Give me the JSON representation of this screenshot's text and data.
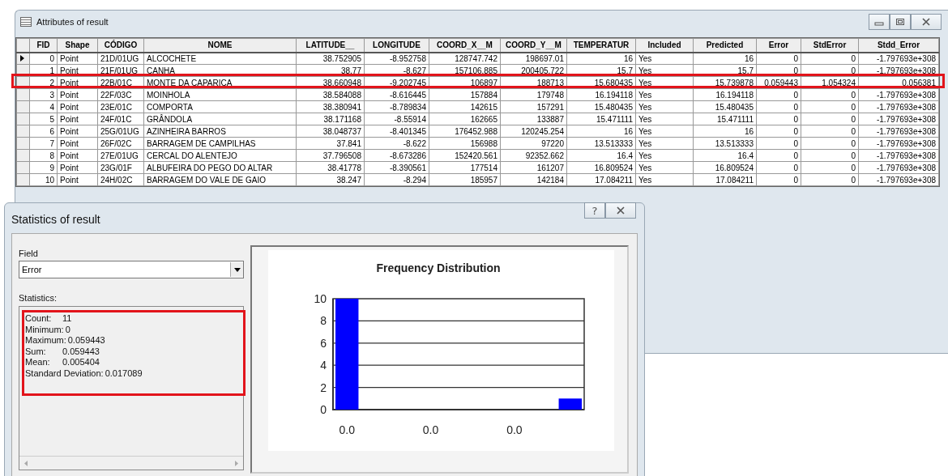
{
  "attributes_window": {
    "title": "Attributes of result"
  },
  "table": {
    "columns": [
      "FID",
      "Shape",
      "CÓDIGO",
      "NOME",
      "LATITUDE__",
      "LONGITUDE",
      "COORD_X__M",
      "COORD_Y__M",
      "TEMPERATUR",
      "Included",
      "Predicted",
      "Error",
      "StdError",
      "Stdd_Error"
    ],
    "rows": [
      {
        "current": true,
        "highlighted": false,
        "cells": [
          "0",
          "Point",
          "21D/01UG",
          "ALCOCHETE",
          "38.752905",
          "-8.952758",
          "128747.742",
          "198697.01",
          "16",
          "Yes",
          "16",
          "0",
          "0",
          "-1.797693e+308"
        ]
      },
      {
        "current": false,
        "highlighted": false,
        "cells": [
          "1",
          "Point",
          "21F/01UG",
          "CANHA",
          "38.77",
          "-8.627",
          "157106.885",
          "200405.722",
          "15.7",
          "Yes",
          "15.7",
          "0",
          "0",
          "-1.797693e+308"
        ]
      },
      {
        "current": false,
        "highlighted": true,
        "cells": [
          "2",
          "Point",
          "22B/01C",
          "MONTE DA CAPARICA",
          "38.660948",
          "-9.202745",
          "106897",
          "188713",
          "15.680435",
          "Yes",
          "15.739878",
          "0.059443",
          "1.054324",
          "0.056381"
        ]
      },
      {
        "current": false,
        "highlighted": false,
        "cells": [
          "3",
          "Point",
          "22F/03C",
          "MOINHOLA",
          "38.584088",
          "-8.616445",
          "157884",
          "179748",
          "16.194118",
          "Yes",
          "16.194118",
          "0",
          "0",
          "-1.797693e+308"
        ]
      },
      {
        "current": false,
        "highlighted": false,
        "cells": [
          "4",
          "Point",
          "23E/01C",
          "COMPORTA",
          "38.380941",
          "-8.789834",
          "142615",
          "157291",
          "15.480435",
          "Yes",
          "15.480435",
          "0",
          "0",
          "-1.797693e+308"
        ]
      },
      {
        "current": false,
        "highlighted": false,
        "cells": [
          "5",
          "Point",
          "24F/01C",
          "GRÂNDOLA",
          "38.171168",
          "-8.55914",
          "162665",
          "133887",
          "15.471111",
          "Yes",
          "15.471111",
          "0",
          "0",
          "-1.797693e+308"
        ]
      },
      {
        "current": false,
        "highlighted": false,
        "cells": [
          "6",
          "Point",
          "25G/01UG",
          "AZINHEIRA BARROS",
          "38.048737",
          "-8.401345",
          "176452.988",
          "120245.254",
          "16",
          "Yes",
          "16",
          "0",
          "0",
          "-1.797693e+308"
        ]
      },
      {
        "current": false,
        "highlighted": false,
        "cells": [
          "7",
          "Point",
          "26F/02C",
          "BARRAGEM DE CAMPILHAS",
          "37.841",
          "-8.622",
          "156988",
          "97220",
          "13.513333",
          "Yes",
          "13.513333",
          "0",
          "0",
          "-1.797693e+308"
        ]
      },
      {
        "current": false,
        "highlighted": false,
        "cells": [
          "8",
          "Point",
          "27E/01UG",
          "CERCAL DO ALENTEJO",
          "37.796508",
          "-8.673286",
          "152420.561",
          "92352.662",
          "16.4",
          "Yes",
          "16.4",
          "0",
          "0",
          "-1.797693e+308"
        ]
      },
      {
        "current": false,
        "highlighted": false,
        "cells": [
          "9",
          "Point",
          "23G/01F",
          "ALBUFEIRA DO PEGO DO ALTAR",
          "38.41778",
          "-8.390561",
          "177514",
          "161207",
          "16.809524",
          "Yes",
          "16.809524",
          "0",
          "0",
          "-1.797693e+308"
        ]
      },
      {
        "current": false,
        "highlighted": false,
        "cells": [
          "10",
          "Point",
          "24H/02C",
          "BARRAGEM DO VALE DE GAIO",
          "38.247",
          "-8.294",
          "185957",
          "142184",
          "17.084211",
          "Yes",
          "17.084211",
          "0",
          "0",
          "-1.797693e+308"
        ]
      }
    ]
  },
  "statistics_dialog": {
    "title": "Statistics of result",
    "help": "?",
    "field_label": "Field",
    "field_value": "Error",
    "statistics_label": "Statistics:",
    "statistics": [
      {
        "label": "Count:",
        "value": "11"
      },
      {
        "label": "Minimum:",
        "value": "0"
      },
      {
        "label": "Maximum:",
        "value": "0.059443"
      },
      {
        "label": "Sum:",
        "value": "0.059443"
      },
      {
        "label": "Mean:",
        "value": "0.005404"
      },
      {
        "label": "Standard Deviation:",
        "value": "0.017089"
      }
    ],
    "chart_data": {
      "type": "bar",
      "title": "Frequency Distribution",
      "categories": [
        "0.0",
        null,
        null,
        "0.0",
        null,
        null,
        "0.0",
        null,
        null
      ],
      "values": [
        10,
        0,
        0,
        0,
        0,
        0,
        0,
        0,
        1
      ],
      "yticks": [
        0,
        2,
        4,
        6,
        8,
        10
      ],
      "ylim": [
        0,
        10
      ],
      "grid": true
    }
  }
}
